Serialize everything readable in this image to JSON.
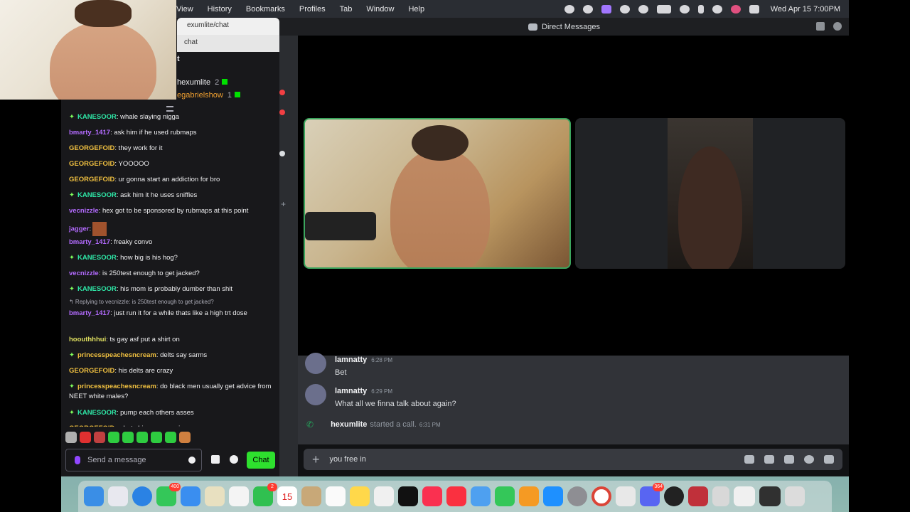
{
  "menubar": {
    "items": [
      "View",
      "History",
      "Bookmarks",
      "Profiles",
      "Tab",
      "Window",
      "Help"
    ],
    "clock": "Wed Apr 15  7:00PM"
  },
  "twitch": {
    "tab_title": "exumlite/chat",
    "url_fragment": "chat",
    "section_label": "t",
    "viewers": [
      {
        "name": "hexumlite",
        "count": "2"
      },
      {
        "name": "egabrielshow",
        "count": "1"
      }
    ],
    "messages": [
      {
        "user": "KANESOOR",
        "color": "#2ee6a6",
        "gem": true,
        "text": ": whale slaying nigga"
      },
      {
        "user": "bmarty_1417",
        "color": "#b36bff",
        "gem": false,
        "text": ": ask him if he used rubmaps"
      },
      {
        "user": "GEORGEFOID",
        "color": "#f0c040",
        "gem": false,
        "text": ": they work for it"
      },
      {
        "user": "GEORGEFOID",
        "color": "#f0c040",
        "gem": false,
        "text": ": YOOOOO"
      },
      {
        "user": "GEORGEFOID",
        "color": "#f0c040",
        "gem": false,
        "text": ": ur gonna start an addiction for bro"
      },
      {
        "user": "KANESOOR",
        "color": "#2ee6a6",
        "gem": true,
        "text": ": ask him it he uses sniffies"
      },
      {
        "user": "vecnizzle",
        "color": "#b36bff",
        "gem": false,
        "text": ": hex got to be sponsored by rubmaps at this point"
      },
      {
        "user": "jagger",
        "color": "#b36bff",
        "gem": false,
        "text": ":",
        "emote": true
      },
      {
        "user": "bmarty_1417",
        "color": "#b36bff",
        "gem": false,
        "text": ": freaky convo"
      },
      {
        "user": "KANESOOR",
        "color": "#2ee6a6",
        "gem": true,
        "text": ": how big is his hog?"
      },
      {
        "user": "vecnizzle",
        "color": "#b36bff",
        "gem": false,
        "text": ": is 250test enough to get jacked?"
      },
      {
        "user": "KANESOOR",
        "color": "#2ee6a6",
        "gem": true,
        "text": ": his mom is probably dumber than shit"
      }
    ],
    "reply_ref": "Replying to vecnizzle: is 250test enough to get jacked?",
    "messages2": [
      {
        "user": "bmarty_1417",
        "color": "#b36bff",
        "gem": false,
        "text": ": just run it for a while thats like a high trt dose"
      },
      {
        "user": "hoouthhhui",
        "color": "#e0e060",
        "gem": false,
        "text": ": ts gay asf put a shirt on"
      },
      {
        "user": "princesspeachesncream",
        "color": "#f0c040",
        "gem": true,
        "text": ": delts say sarms"
      },
      {
        "user": "GEORGEFOID",
        "color": "#f0c040",
        "gem": false,
        "text": ": his delts are crazy"
      },
      {
        "user": "princesspeachesncream",
        "color": "#f0c040",
        "gem": true,
        "text": ": do black men usually get advice from NEET white males?"
      },
      {
        "user": "KANESOOR",
        "color": "#2ee6a6",
        "gem": true,
        "text": ": pump each others asses"
      },
      {
        "user": "GEORGEFOID",
        "color": "#f0c040",
        "gem": false,
        "text": ": whats his name again"
      }
    ],
    "input_placeholder": "Send a message",
    "chat_button": "Chat"
  },
  "discord": {
    "title": "Direct Messages",
    "messages": [
      {
        "user": "lamnatty",
        "time": "6:28 PM",
        "text": "Bet"
      },
      {
        "user": "lamnatty",
        "time": "6:29 PM",
        "text": "What all we finna talk about again?"
      }
    ],
    "call_notice": {
      "user": "hexumlite",
      "text": "started a call.",
      "time": "6:31 PM"
    },
    "composer_value": "you free in"
  },
  "dock": {
    "badges": {
      "appstore": "400",
      "facetime": "2",
      "discord": "364"
    },
    "calendar_day": "15"
  },
  "colors": {
    "twitch_bg": "#18181b",
    "discord_bg": "#313338",
    "speaking_border": "#3ba55d",
    "chat_button": "#2ee02e"
  }
}
